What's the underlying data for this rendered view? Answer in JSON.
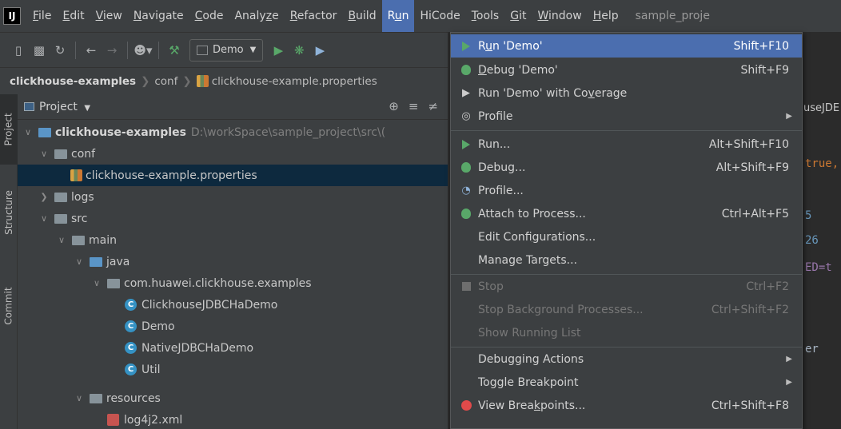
{
  "menubar": {
    "logo": "IJ",
    "items": [
      {
        "pre": "",
        "mn": "F",
        "post": "ile"
      },
      {
        "pre": "",
        "mn": "E",
        "post": "dit"
      },
      {
        "pre": "",
        "mn": "V",
        "post": "iew"
      },
      {
        "pre": "",
        "mn": "N",
        "post": "avigate"
      },
      {
        "pre": "",
        "mn": "C",
        "post": "ode"
      },
      {
        "pre": "Analy",
        "mn": "z",
        "post": "e"
      },
      {
        "pre": "",
        "mn": "R",
        "post": "efactor"
      },
      {
        "pre": "",
        "mn": "B",
        "post": "uild"
      },
      {
        "pre": "R",
        "mn": "u",
        "post": "n"
      },
      {
        "pre": "HiCode",
        "mn": "",
        "post": ""
      },
      {
        "pre": "",
        "mn": "T",
        "post": "ools"
      },
      {
        "pre": "",
        "mn": "G",
        "post": "it"
      },
      {
        "pre": "",
        "mn": "W",
        "post": "indow"
      },
      {
        "pre": "",
        "mn": "H",
        "post": "elp"
      }
    ],
    "title": "sample_proje"
  },
  "toolbar": {
    "run_config": "Demo",
    "icons": [
      "open-icon",
      "save-icon",
      "sync-icon",
      "back-icon",
      "forward-icon",
      "user-icon",
      "build-hammer-icon",
      "run-icon",
      "debug-icon",
      "coverage-icon"
    ]
  },
  "breadcrumb": {
    "project": "clickhouse-examples",
    "folder": "conf",
    "file": "clickhouse-example.properties"
  },
  "side_tabs": {
    "project": "Project",
    "structure": "Structure",
    "commit": "Commit"
  },
  "project_panel": {
    "title": "Project",
    "tree": [
      {
        "label": "clickhouse-examples",
        "extra": "D:\\workSpace\\sample_project\\src\\("
      },
      {
        "label": "conf"
      },
      {
        "label": "clickhouse-example.properties"
      },
      {
        "label": "logs"
      },
      {
        "label": "src"
      },
      {
        "label": "main"
      },
      {
        "label": "java"
      },
      {
        "label": "com.huawei.clickhouse.examples"
      },
      {
        "label": "ClickhouseJDBCHaDemo"
      },
      {
        "label": "Demo"
      },
      {
        "label": "NativeJDBCHaDemo"
      },
      {
        "label": "Util"
      },
      {
        "label": "resources"
      },
      {
        "label": "log4j2.xml"
      }
    ]
  },
  "editor": {
    "tab": "useJDE",
    "code_lines": [
      "true,",
      "5",
      "26",
      "ED=t",
      "er"
    ]
  },
  "run_menu": {
    "items": [
      {
        "pre": "R",
        "mn": "u",
        "post": "n 'Demo'",
        "shortcut": "Shift+F10"
      },
      {
        "pre": "",
        "mn": "D",
        "post": "ebug 'Demo'",
        "shortcut": "Shift+F9"
      },
      {
        "pre": "Run 'Demo' with Co",
        "mn": "v",
        "post": "erage",
        "shortcut": ""
      },
      {
        "pre": "Profile",
        "mn": "",
        "post": "",
        "shortcut": ""
      },
      {
        "pre": "Run...",
        "mn": "",
        "post": "",
        "shortcut": "Alt+Shift+F10"
      },
      {
        "pre": "Debug...",
        "mn": "",
        "post": "",
        "shortcut": "Alt+Shift+F9"
      },
      {
        "pre": "Profile...",
        "mn": "",
        "post": "",
        "shortcut": ""
      },
      {
        "pre": "Attach to Process...",
        "mn": "",
        "post": "",
        "shortcut": "Ctrl+Alt+F5"
      },
      {
        "pre": "Edit Confi",
        "mn": "g",
        "post": "urations...",
        "shortcut": ""
      },
      {
        "pre": "Manage Targets...",
        "mn": "",
        "post": "",
        "shortcut": ""
      },
      {
        "pre": "Stop",
        "mn": "",
        "post": "",
        "shortcut": "Ctrl+F2"
      },
      {
        "pre": "Stop Background Processes...",
        "mn": "",
        "post": "",
        "shortcut": "Ctrl+Shift+F2"
      },
      {
        "pre": "Show Running List",
        "mn": "",
        "post": "",
        "shortcut": ""
      },
      {
        "pre": "Debugging Actions",
        "mn": "",
        "post": "",
        "shortcut": ""
      },
      {
        "pre": "Toggle Breakpoint",
        "mn": "",
        "post": "",
        "shortcut": ""
      },
      {
        "pre": "View Brea",
        "mn": "k",
        "post": "points...",
        "shortcut": "Ctrl+Shift+F8"
      }
    ]
  }
}
